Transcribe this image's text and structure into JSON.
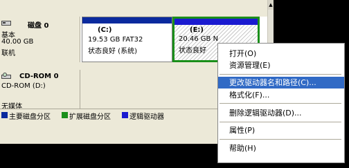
{
  "disk0": {
    "label": "磁盘 0",
    "type": "基本",
    "size": "40.00 GB",
    "status": "联机",
    "partition_c": {
      "name": "(C:)",
      "size": "19.53 GB FAT32",
      "status": "状态良好 (系统)"
    },
    "partition_e": {
      "name": "(E:)",
      "size": "20.46 GB N",
      "status": "状态良好"
    }
  },
  "cdrom0": {
    "label": "CD-ROM 0",
    "type": "CD-ROM (D:)",
    "media": "无媒体"
  },
  "legend": [
    {
      "label": "主要磁盘分区",
      "color": "#0a2a9e"
    },
    {
      "label": "扩展磁盘分区",
      "color": "#1a8f1a"
    },
    {
      "label": "逻辑驱动器",
      "color": "#1a1ad0"
    }
  ],
  "context_menu": [
    {
      "label": "打开(O)",
      "highlighted": false
    },
    {
      "label": "资源管理(E)",
      "highlighted": false
    },
    {
      "label": "更改驱动器名和路径(C)...",
      "highlighted": true
    },
    {
      "label": "格式化(F)...",
      "highlighted": false
    },
    {
      "label": "删除逻辑驱动器(D)...",
      "highlighted": false
    },
    {
      "label": "属性(P)",
      "highlighted": false
    },
    {
      "label": "帮助(H)",
      "highlighted": false
    }
  ]
}
